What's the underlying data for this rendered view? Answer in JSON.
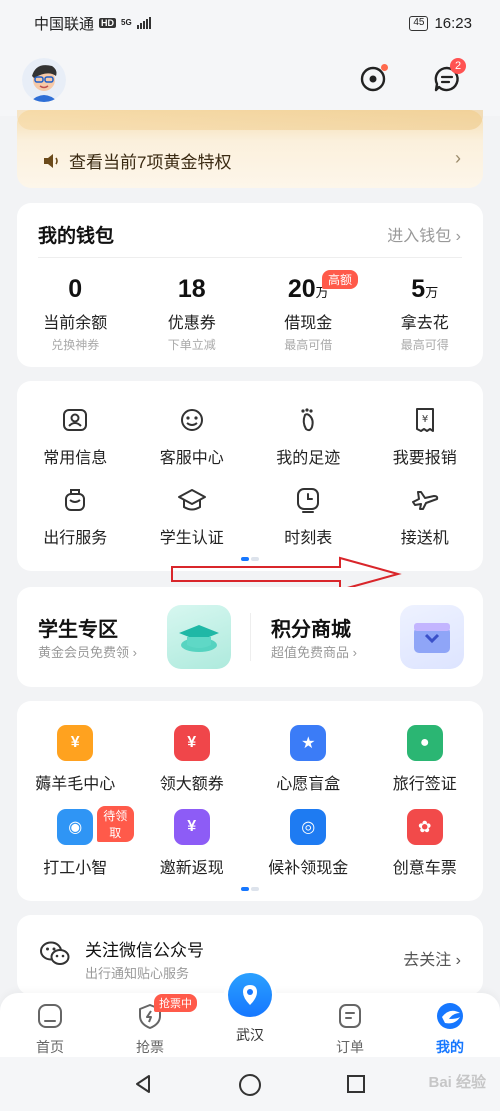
{
  "status_bar": {
    "carrier": "中国联通",
    "hd": "HD",
    "network": "5G",
    "battery": "45",
    "time": "16:23"
  },
  "header": {
    "message_badge": "2"
  },
  "gold_banner": {
    "text": "查看当前7项黄金特权"
  },
  "wallet": {
    "title": "我的钱包",
    "enter_label": "进入钱包",
    "items": [
      {
        "value": "0",
        "unit": "",
        "label": "当前余额",
        "sub": "兑换神券"
      },
      {
        "value": "18",
        "unit": "",
        "label": "优惠券",
        "sub": "下单立减"
      },
      {
        "value": "20",
        "unit": "万",
        "label": "借现金",
        "sub": "最高可借",
        "tag": "高额"
      },
      {
        "value": "5",
        "unit": "万",
        "label": "拿去花",
        "sub": "最高可得"
      }
    ]
  },
  "services": {
    "row1": [
      {
        "label": "常用信息",
        "icon": "contact-card-icon"
      },
      {
        "label": "客服中心",
        "icon": "customer-service-icon"
      },
      {
        "label": "我的足迹",
        "icon": "footprint-icon"
      },
      {
        "label": "我要报销",
        "icon": "receipt-icon"
      }
    ],
    "row2": [
      {
        "label": "出行服务",
        "icon": "luggage-icon"
      },
      {
        "label": "学生认证",
        "icon": "graduation-cap-icon"
      },
      {
        "label": "时刻表",
        "icon": "clock-icon"
      },
      {
        "label": "接送机",
        "icon": "airplane-icon"
      }
    ]
  },
  "zones": {
    "student": {
      "title": "学生专区",
      "sub": "黄金会员免费领"
    },
    "points": {
      "title": "积分商城",
      "sub": "超值免费商品"
    }
  },
  "promos": {
    "row1": [
      {
        "label": "薅羊毛中心",
        "icon": "yen-coupon-icon",
        "color": "#ffa21f",
        "glyph": "¥"
      },
      {
        "label": "领大额券",
        "icon": "coupon-icon",
        "color": "#f0464a",
        "glyph": "¥"
      },
      {
        "label": "心愿盲盒",
        "icon": "gift-box-icon",
        "color": "#3b7cf7",
        "glyph": "★"
      },
      {
        "label": "旅行签证",
        "icon": "visa-icon",
        "color": "#2bb673",
        "glyph": "●"
      }
    ],
    "row2": [
      {
        "label": "打工小智",
        "icon": "robot-icon",
        "color": "#2f95f5",
        "glyph": "◉",
        "tag": "待领取"
      },
      {
        "label": "邀新返现",
        "icon": "cashback-icon",
        "color": "#8d5cf6",
        "glyph": "¥"
      },
      {
        "label": "候补领现金",
        "icon": "train-icon",
        "color": "#1e7bf2",
        "glyph": "◎"
      },
      {
        "label": "创意车票",
        "icon": "ticket-icon",
        "color": "#f24a4a",
        "glyph": "✿"
      }
    ]
  },
  "follow": {
    "title": "关注微信公众号",
    "sub": "出行通知贴心服务",
    "button": "去关注"
  },
  "bottom_nav": {
    "home": "首页",
    "grab": "抢票",
    "grab_tag": "抢票中",
    "city": "武汉",
    "order": "订单",
    "mine": "我的"
  },
  "watermark": "Bai 经验"
}
